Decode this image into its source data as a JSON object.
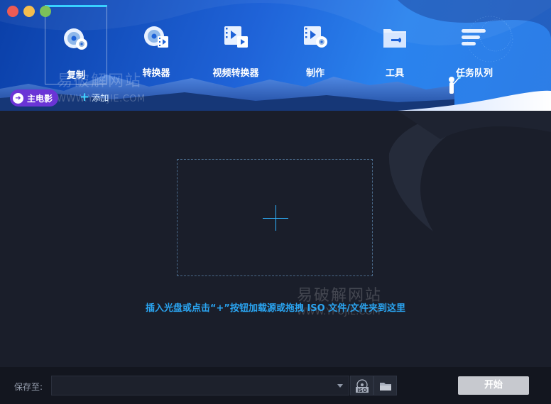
{
  "window": {
    "controls": [
      "close",
      "minimize",
      "maximize"
    ]
  },
  "nav": {
    "items": [
      {
        "label": "复制",
        "icon": "disc-copy-icon",
        "active": true
      },
      {
        "label": "转换器",
        "icon": "disc-converter-icon",
        "active": false
      },
      {
        "label": "视频转换器",
        "icon": "video-converter-icon",
        "active": false
      },
      {
        "label": "制作",
        "icon": "disc-creator-icon",
        "active": false
      },
      {
        "label": "工具",
        "icon": "toolbox-icon",
        "active": false
      },
      {
        "label": "任务队列",
        "icon": "task-queue-icon",
        "active": false
      }
    ]
  },
  "watermark": {
    "title": "易破解网站",
    "url": "WWW.YPOJIE.COM"
  },
  "source": {
    "movie_label": "主电影",
    "add_label": "添加"
  },
  "main": {
    "hint": "插入光盘或点击“+”按钮加载源或拖拽 ISO 文件/文件夹到这里"
  },
  "footer": {
    "save_label": "保存至:",
    "path_value": "",
    "iso_label": "ISO",
    "start_label": "开始"
  },
  "colors": {
    "accent": "#2aa4f0",
    "header_start": "#0a3fa8",
    "header_end": "#2d7de6",
    "pill": "#6a34d6",
    "start_disabled": "#c7c9cf"
  }
}
